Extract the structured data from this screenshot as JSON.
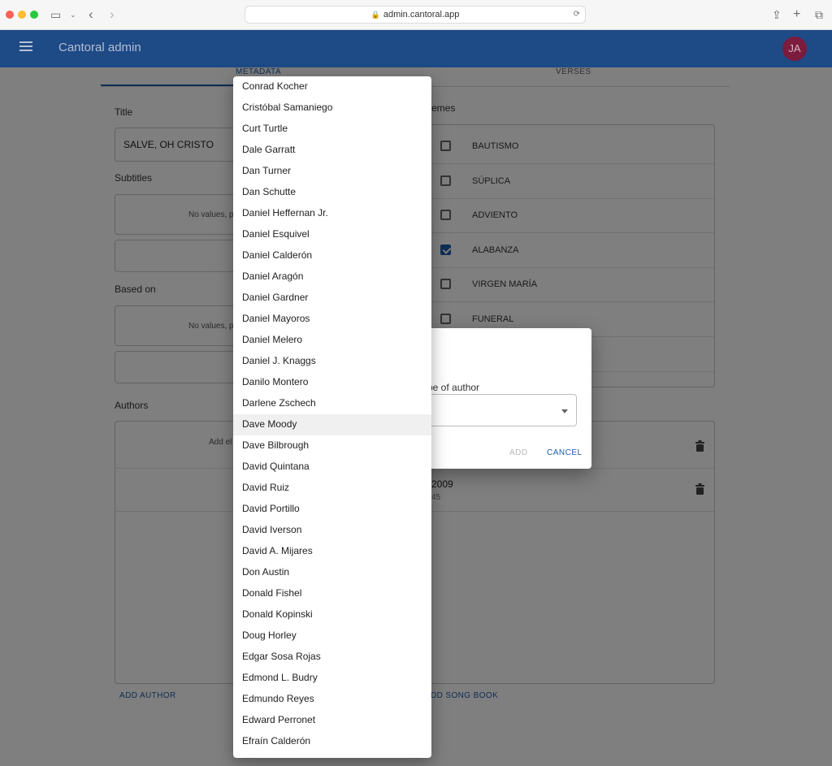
{
  "browser": {
    "url": "admin.cantoral.app"
  },
  "appbar": {
    "title": "Cantoral admin",
    "avatar_initials": "JA",
    "color": "#1e4a86"
  },
  "tabs": [
    "METADATA",
    "VERSES"
  ],
  "form": {
    "title_label": "Title",
    "title_value": "SALVE, OH CRISTO",
    "subtitles_label": "Subtitles",
    "subtitles_empty": "No values, p",
    "based_on_label": "Based on",
    "based_on_empty": "No values, p",
    "authors_label": "Authors",
    "authors_empty": "Add el",
    "add_author": "ADD AUTHOR",
    "add_song_book": "DD SONG BOOK",
    "themes_label": "emes",
    "themes": [
      {
        "label": "BAUTISMO",
        "checked": false
      },
      {
        "label": "SÚPLICA",
        "checked": false
      },
      {
        "label": "ADVIENTO",
        "checked": false
      },
      {
        "label": "ALABANZA",
        "checked": true
      },
      {
        "label": "VIRGEN MARÍA",
        "checked": false
      },
      {
        "label": "FUNERAL",
        "checked": false
      }
    ],
    "song_book_year": "2009",
    "song_book_page": "45"
  },
  "dialog": {
    "type_label": "pe of author",
    "add": "ADD",
    "cancel": "CANCEL"
  },
  "menu": {
    "items": [
      "Conrad Kocher",
      "Cristóbal Samaniego",
      "Curt Turtle",
      "Dale Garratt",
      "Dan Turner",
      "Dan Schutte",
      "Daniel Heffernan Jr.",
      "Daniel Esquivel",
      "Daniel Calderón",
      "Daniel Aragón",
      "Daniel Gardner",
      "Daniel Mayoros",
      "Daniel Melero",
      "Daniel J. Knaggs",
      "Danilo Montero",
      "Darlene Zschech",
      "Dave Moody",
      "Dave Bilbrough",
      "David Quintana",
      "David Ruiz",
      "David Portillo",
      "David Iverson",
      "David A. Mijares",
      "Don Austin",
      "Donald Fishel",
      "Donald Kopinski",
      "Doug Horley",
      "Edgar Sosa Rojas",
      "Edmond L. Budry",
      "Edmundo Reyes",
      "Edward Perronet",
      "Efraín Calderón"
    ],
    "highlighted": "Dave Moody"
  }
}
